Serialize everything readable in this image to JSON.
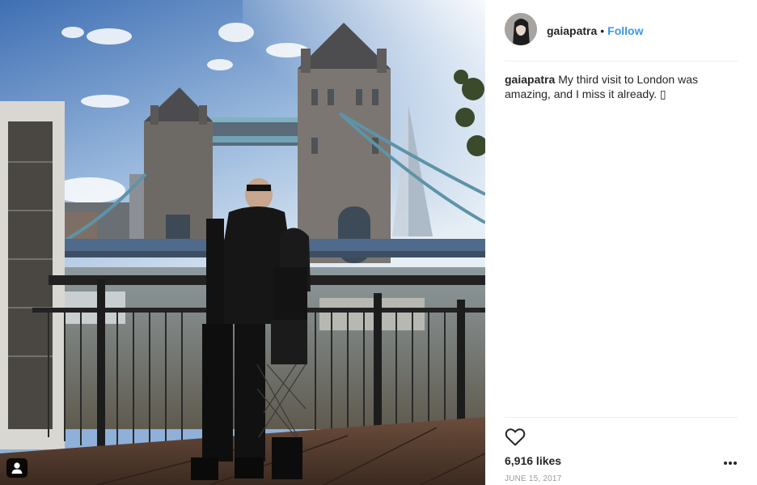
{
  "post": {
    "username": "gaiapatra",
    "separator": "•",
    "follow_label": "Follow",
    "caption": {
      "username": "gaiapatra",
      "text": "My third visit to London was amazing, and I miss it already. ▯"
    },
    "likes": "6,916 likes",
    "date": "June 15, 2017"
  },
  "icons": {
    "like": "heart-outline-icon",
    "more": "more-options-icon",
    "tag": "user-tag-icon"
  },
  "colors": {
    "link_blue": "#3897f0",
    "text": "#262626",
    "muted": "#999999",
    "divider": "#efefef"
  }
}
